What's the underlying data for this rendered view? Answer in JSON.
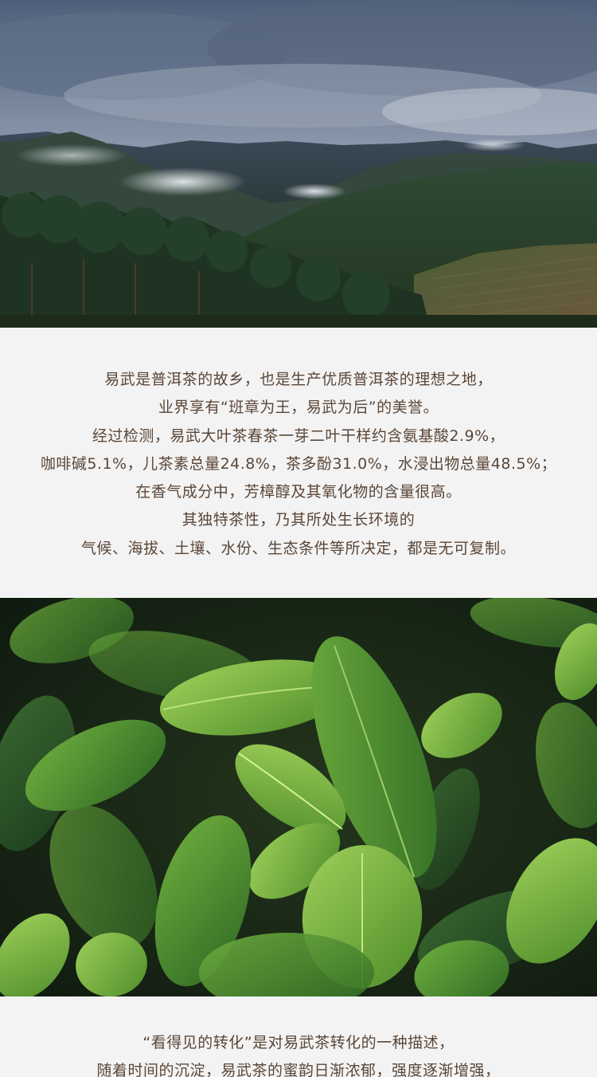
{
  "sections": {
    "mountain_photo": {
      "alt": "mountain-landscape-photo"
    },
    "intro": {
      "lines": [
        "易武是普洱茶的故乡，也是生产优质普洱茶的理想之地，",
        "业界享有“班章为王，易武为后”的美誉。",
        "经过检测，易武大叶茶春茶一芽二叶干样约含氨基酸2.9%，",
        "咖啡碱5.1%，儿茶素总量24.8%，茶多酚31.0%，水浸出物总量48.5%；",
        "在香气成分中，芳樟醇及其氧化物的含量很高。",
        "其独特茶性，乃其所处生长环境的",
        "气候、海拔、土壤、水份、生态条件等所决定，都是无可复制。"
      ]
    },
    "leaves_photo": {
      "alt": "tea-leaves-photo"
    },
    "outro": {
      "lines": [
        "“看得见的转化”是对易武茶转化的一种描述，",
        "随着时间的沉淀，易武茶的蜜韵日渐浓郁，强度逐渐增强，"
      ]
    }
  },
  "colors": {
    "text": "#5a4638",
    "background": "#f3f3f3",
    "sky": "#6e7f97",
    "forest": "#2e4a2a",
    "leaf": "#5f9b35"
  }
}
